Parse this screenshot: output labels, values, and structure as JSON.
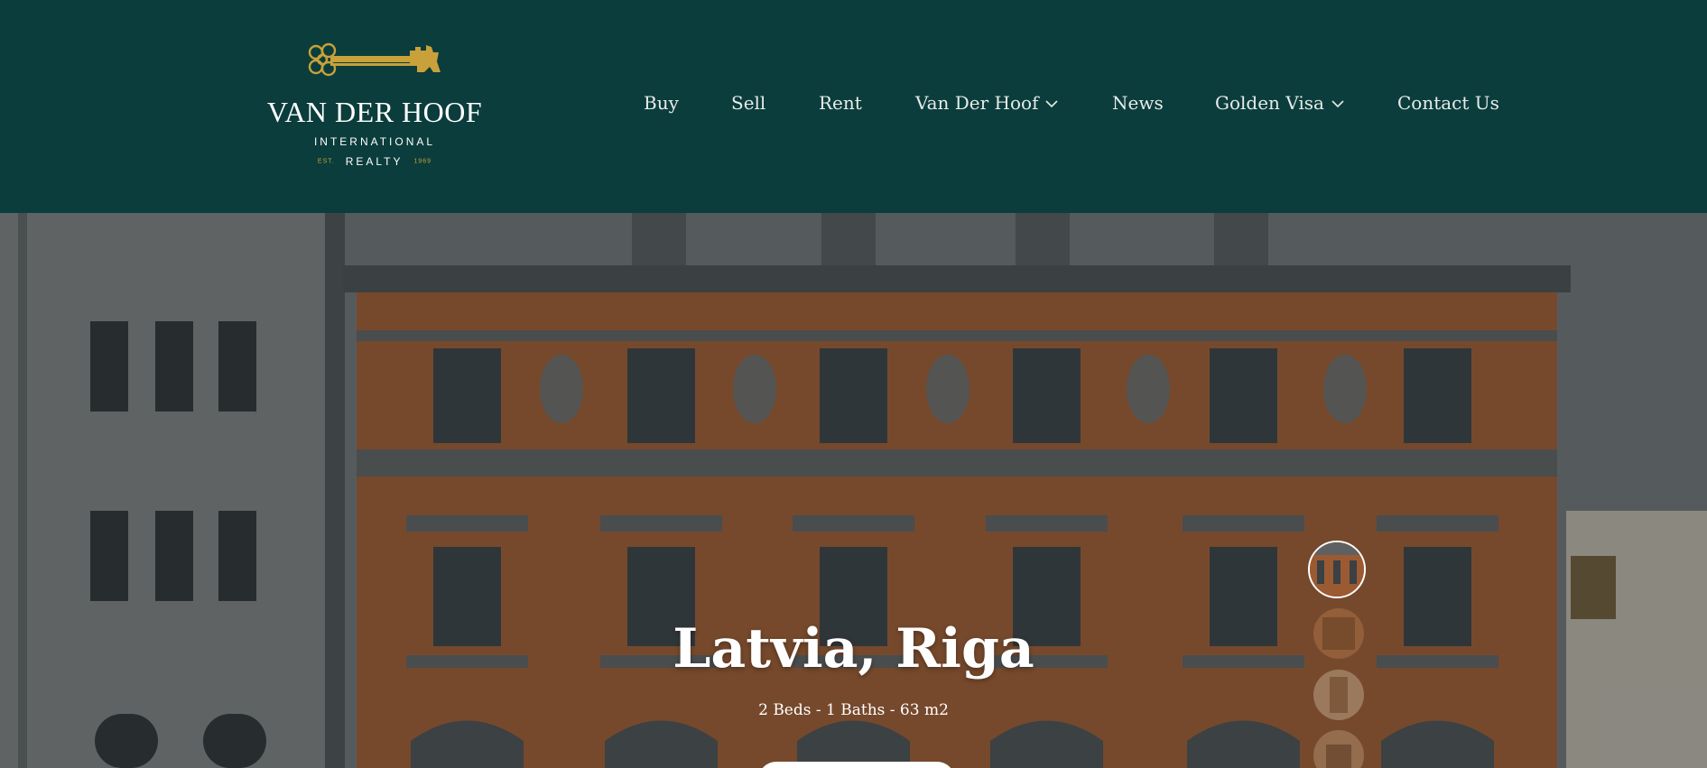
{
  "brand": {
    "name": "VAN DER HOOF",
    "sub": "INTERNATIONAL",
    "est": "EST.",
    "realty": "REALTY",
    "year": "1969",
    "colors": {
      "header_bg": "#0b3d3c",
      "gold": "#c9a13a"
    }
  },
  "nav": {
    "items": [
      {
        "label": "Buy",
        "dropdown": false
      },
      {
        "label": "Sell",
        "dropdown": false
      },
      {
        "label": "Rent",
        "dropdown": false
      },
      {
        "label": "Van Der Hoof",
        "dropdown": true
      },
      {
        "label": "News",
        "dropdown": false
      },
      {
        "label": "Golden Visa",
        "dropdown": true
      },
      {
        "label": "Contact Us",
        "dropdown": false
      }
    ]
  },
  "hero": {
    "title": "Latvia, Riga",
    "details": "2 Beds - 1 Baths - 63 m2",
    "thumbnails_count": 4,
    "active_thumbnail": 1
  }
}
